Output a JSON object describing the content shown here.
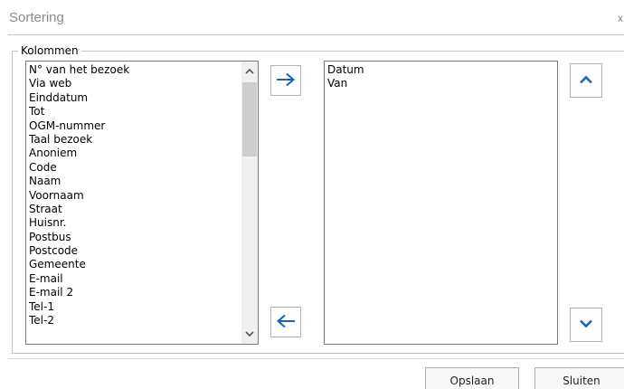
{
  "dialog": {
    "title": "Sortering",
    "close_label": "x"
  },
  "group": {
    "legend": "Kolommen"
  },
  "available_columns": [
    "N° van het bezoek",
    "Via web",
    "Einddatum",
    "Tot",
    "OGM-nummer",
    "Taal bezoek",
    "Anoniem",
    "Code",
    "Naam",
    "Voornaam",
    "Straat",
    "Huisnr.",
    "Postbus",
    "Postcode",
    "Gemeente",
    "E-mail",
    "E-mail 2",
    "Tel-1",
    "Tel-2"
  ],
  "sort_columns": [
    "Datum",
    "Van"
  ],
  "icons": {
    "add": "arrow-right-icon",
    "remove": "arrow-left-icon",
    "move_up": "chevron-up-icon",
    "move_down": "chevron-down-icon",
    "scroll_up": "scroll-up-icon",
    "scroll_down": "scroll-down-icon"
  },
  "colors": {
    "accent": "#1a66b0"
  },
  "buttons": {
    "save": "Opslaan",
    "close": "Sluiten"
  }
}
